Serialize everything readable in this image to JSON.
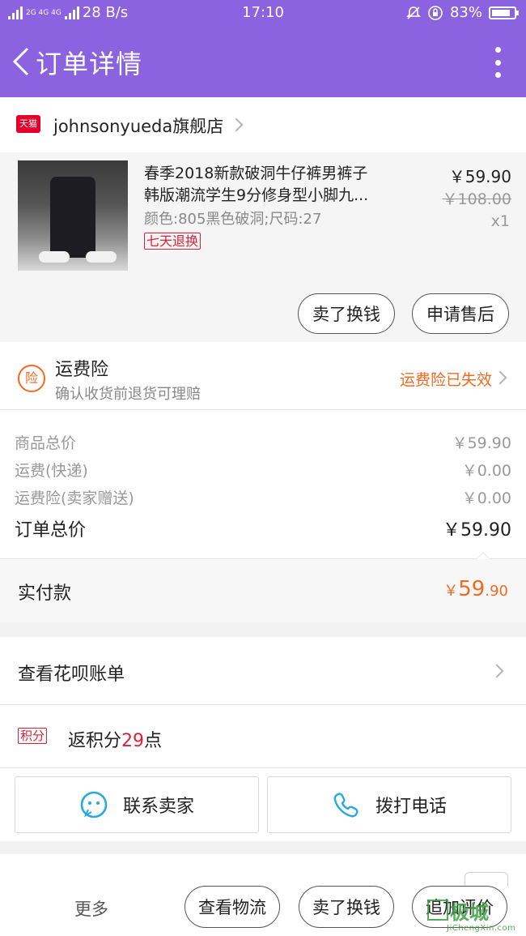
{
  "status_bar": {
    "network": "2G 4G 4G",
    "speed": "28 B/s",
    "time": "17:10",
    "battery": "83%"
  },
  "header": {
    "title": "订单详情"
  },
  "shop": {
    "badge": "天猫",
    "name": "johnsonyueda旗舰店"
  },
  "product": {
    "title_line1": "春季2018新款破洞牛仔裤男裤子",
    "title_line2": "韩版潮流学生9分修身型小脚九...",
    "spec": "颜色:805黑色破洞;尺码:27",
    "return_badge": "七天退换",
    "price": "￥59.90",
    "original_price": "￥108.00",
    "quantity": "x1",
    "actions": [
      "卖了换钱",
      "申请售后"
    ]
  },
  "insurance": {
    "badge": "险",
    "title": "运费险",
    "subtitle": "确认收货前退货可理赔",
    "status": "运费险已失效"
  },
  "costs": [
    {
      "label": "商品总价",
      "value": "￥59.90"
    },
    {
      "label": "运费(快递)",
      "value": "￥0.00"
    },
    {
      "label": "运费险(卖家赠送)",
      "value": "￥0.00"
    }
  ],
  "total": {
    "label": "订单总价",
    "value": "￥59.90"
  },
  "paid": {
    "label": "实付款",
    "currency": "￥",
    "integer": "59",
    "decimal": ".90"
  },
  "huabei": {
    "label": "查看花呗账单"
  },
  "points": {
    "tag": "积分",
    "prefix": "返积分",
    "amount": "29",
    "suffix": "点"
  },
  "contact": {
    "seller": "联系卖家",
    "phone": "拨打电话"
  },
  "bottom": {
    "more": "更多",
    "buttons": [
      "查看物流",
      "卖了换钱",
      "追加评价"
    ]
  },
  "watermark": {
    "brand": "极城",
    "url": "JiChengXin.com"
  },
  "colors": {
    "brand": "#8b63e0",
    "accent": "#f06a21",
    "red": "#d8223a"
  }
}
